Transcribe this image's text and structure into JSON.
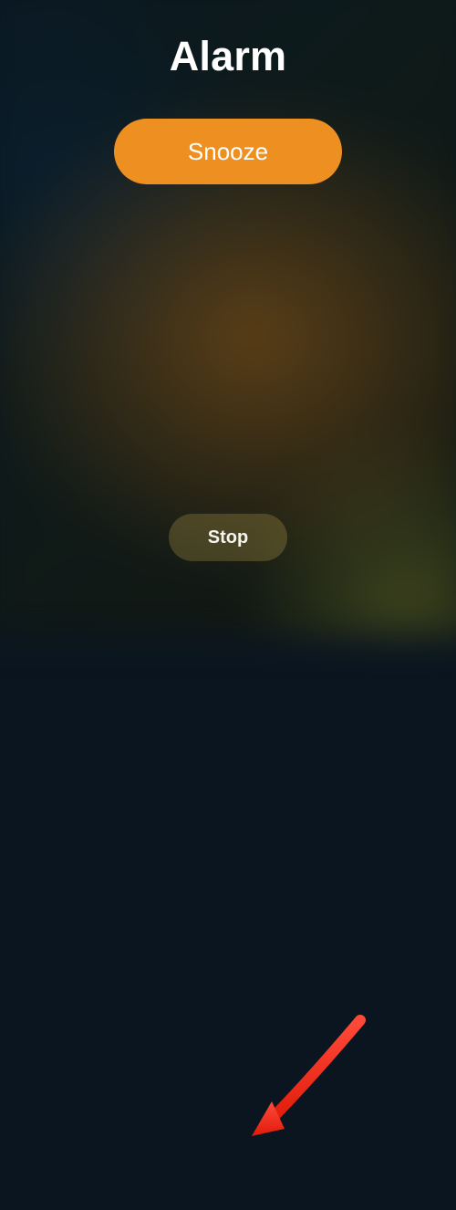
{
  "title": "Alarm",
  "snooze_label": "Snooze",
  "stop_label": "Stop"
}
